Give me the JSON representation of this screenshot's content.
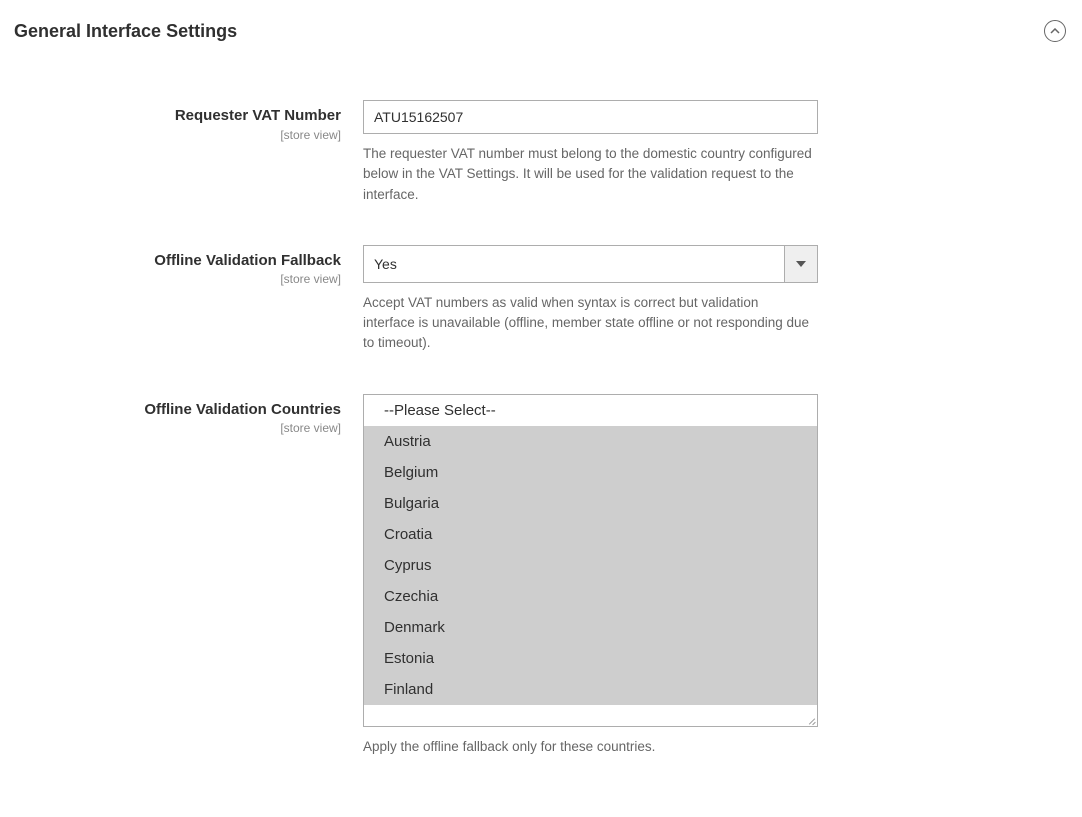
{
  "section": {
    "title": "General Interface Settings"
  },
  "fields": {
    "requester_vat": {
      "label": "Requester VAT Number",
      "scope": "[store view]",
      "value": "ATU15162507",
      "hint": "The requester VAT number must belong to the domestic country configured below in the VAT Settings. It will be used for the validation request to the interface."
    },
    "offline_fallback": {
      "label": "Offline Validation Fallback",
      "scope": "[store view]",
      "value": "Yes",
      "hint": "Accept VAT numbers as valid when syntax is correct but validation interface is unavailable (offline, member state offline or not responding due to timeout)."
    },
    "offline_countries": {
      "label": "Offline Validation Countries",
      "scope": "[store view]",
      "placeholder_option": "--Please Select--",
      "options": [
        "Austria",
        "Belgium",
        "Bulgaria",
        "Croatia",
        "Cyprus",
        "Czechia",
        "Denmark",
        "Estonia",
        "Finland"
      ],
      "hint": "Apply the offline fallback only for these countries."
    }
  }
}
